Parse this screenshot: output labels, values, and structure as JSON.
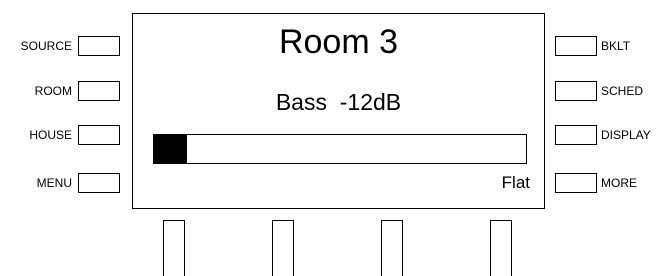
{
  "left_buttons": [
    "SOURCE",
    "ROOM",
    "HOUSE",
    "MENU"
  ],
  "right_buttons": [
    "BKLT",
    "SCHED",
    "DISPLAY",
    "MORE"
  ],
  "display": {
    "title": "Room 3",
    "subtitle": "Bass  -12dB",
    "level_fraction": 0.09,
    "status": "Flat"
  },
  "bottom_buttons_count": 4
}
